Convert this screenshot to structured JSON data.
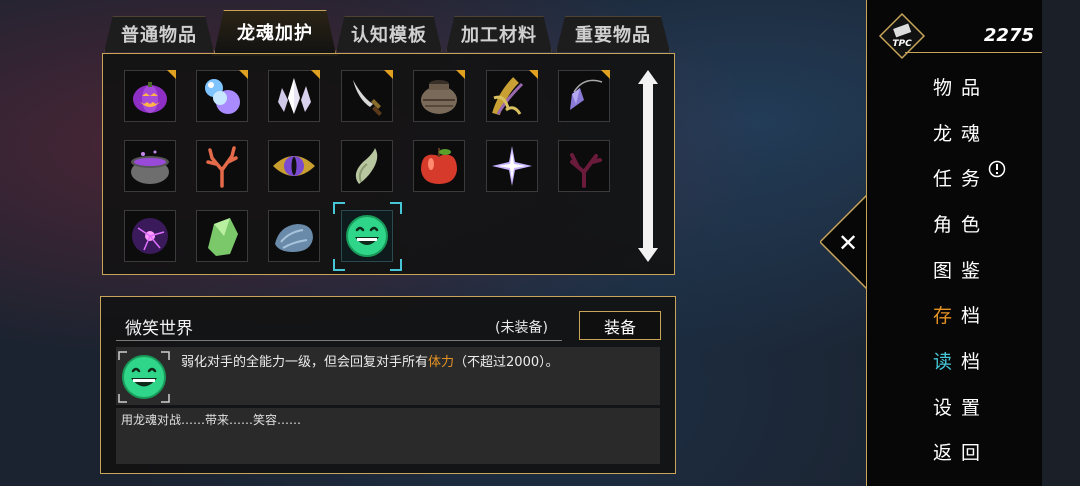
{
  "tabs": [
    {
      "label": "普通物品",
      "active": false
    },
    {
      "label": "龙魂加护",
      "active": true
    },
    {
      "label": "认知模板",
      "active": false
    },
    {
      "label": "加工材料",
      "active": false
    },
    {
      "label": "重要物品",
      "active": false
    }
  ],
  "items": [
    {
      "icon": "pumpkin-lantern-icon",
      "marked": true
    },
    {
      "icon": "crystal-slime-icon",
      "marked": true
    },
    {
      "icon": "white-crystal-icon",
      "marked": true
    },
    {
      "icon": "dagger-icon",
      "marked": true
    },
    {
      "icon": "clay-pot-icon",
      "marked": true
    },
    {
      "icon": "corn-icon",
      "marked": true
    },
    {
      "icon": "pendant-crystal-icon",
      "marked": true
    },
    {
      "icon": "purple-cauldron-icon",
      "marked": false
    },
    {
      "icon": "coral-icon",
      "marked": false
    },
    {
      "icon": "dragon-eye-icon",
      "marked": false
    },
    {
      "icon": "horn-icon",
      "marked": false
    },
    {
      "icon": "apple-icon",
      "marked": false
    },
    {
      "icon": "star-crystal-icon",
      "marked": false
    },
    {
      "icon": "dark-coral-icon",
      "marked": false
    },
    {
      "icon": "plasma-orb-icon",
      "marked": false
    },
    {
      "icon": "green-ore-icon",
      "marked": false
    },
    {
      "icon": "blue-fur-icon",
      "marked": false
    },
    {
      "icon": "smile-face-icon",
      "marked": false,
      "selected": true
    }
  ],
  "detail": {
    "name": "微笑世界",
    "status": "(未装备)",
    "equip_label": "装备",
    "desc_before": "弱化对手的全能力一级，但会回复对手所有",
    "desc_highlight": "体力",
    "desc_after": "（不超过2000）。",
    "flavor": "用龙魂对战……带来……笑容……"
  },
  "currency": {
    "badge": "TPC",
    "value": "2275"
  },
  "menu": [
    {
      "label": "物品",
      "color": "#ffffff"
    },
    {
      "label": "龙魂",
      "color": "#ffffff"
    },
    {
      "label": "任务",
      "color": "#ffffff",
      "alert": true
    },
    {
      "label": "角色",
      "color": "#ffffff"
    },
    {
      "label": "图鉴",
      "color": "#ffffff"
    },
    {
      "label": "存档",
      "color": "#ffffff",
      "first_color": "#e59324"
    },
    {
      "label": "读档",
      "color": "#ffffff",
      "first_color": "#47c6d8"
    },
    {
      "label": "设置",
      "color": "#ffffff"
    },
    {
      "label": "返回",
      "color": "#ffffff"
    }
  ],
  "colors": {
    "gold": "#c9a55a",
    "mark": "#e0a020",
    "select": "#47c6d8",
    "highlight": "#e59324"
  }
}
